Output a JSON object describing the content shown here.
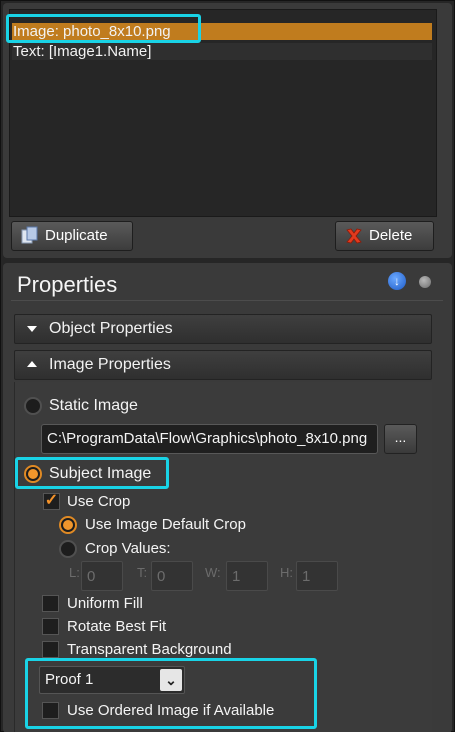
{
  "object_list": {
    "items": [
      "Image: photo_8x10.png",
      "Text: [Image1.Name]"
    ]
  },
  "buttons": {
    "duplicate": "Duplicate",
    "delete": "Delete",
    "browse": "..."
  },
  "properties": {
    "title": "Properties",
    "sections": {
      "object": "Object Properties",
      "image": "Image Properties"
    },
    "image": {
      "static_image_label": "Static Image",
      "path_value": "C:\\ProgramData\\Flow\\Graphics\\photo_8x10.png",
      "subject_image_label": "Subject Image",
      "use_crop_label": "Use Crop",
      "use_default_crop_label": "Use Image Default Crop",
      "crop_values_label": "Crop Values:",
      "crop": {
        "l_label": "L:",
        "l_value": "0",
        "t_label": "T:",
        "t_value": "0",
        "w_label": "W:",
        "w_value": "1",
        "h_label": "H:",
        "h_value": "1"
      },
      "uniform_fill_label": "Uniform Fill",
      "rotate_best_fit_label": "Rotate Best Fit",
      "transparent_background_label": "Transparent Background",
      "proof_select_value": "Proof 1",
      "use_ordered_image_label": "Use Ordered Image if Available"
    }
  },
  "colors": {
    "accent": "#f0962c",
    "highlight": "#19d3e6",
    "selection": "#c07c1e"
  }
}
